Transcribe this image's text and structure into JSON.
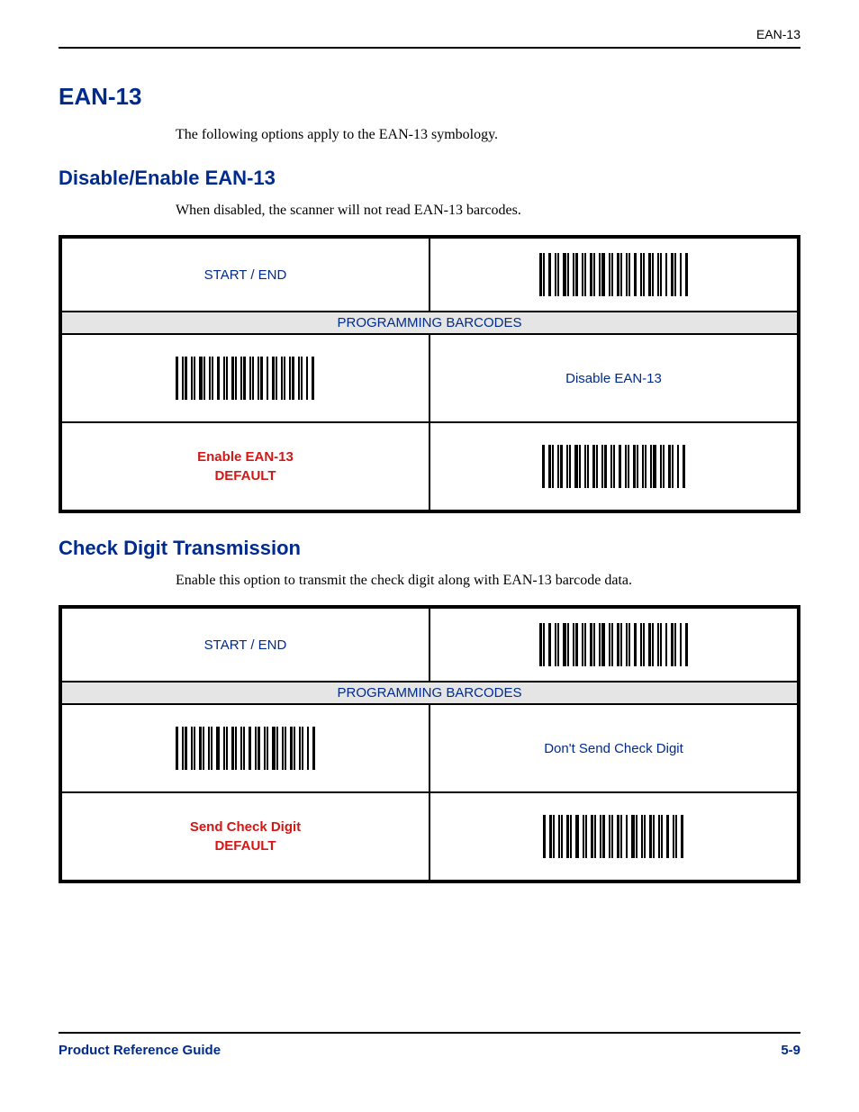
{
  "header": {
    "running_head": "EAN-13"
  },
  "section": {
    "title": "EAN-13",
    "intro": "The following options apply to the EAN-13 symbology."
  },
  "sub1": {
    "title": "Disable/Enable EAN-13",
    "intro": "When disabled, the scanner will not read EAN-13 barcodes.",
    "start_end": "START / END",
    "banner": "PROGRAMMING BARCODES",
    "opt_disable": "Disable EAN-13",
    "opt_enable_line1": "Enable EAN-13",
    "opt_enable_line2": "DEFAULT"
  },
  "sub2": {
    "title": "Check Digit Transmission",
    "intro": "Enable this option to transmit the check digit along with EAN-13 barcode data.",
    "start_end": "START / END",
    "banner": "PROGRAMMING BARCODES",
    "opt_nosend": "Don't Send Check Digit",
    "opt_send_line1": "Send Check Digit",
    "opt_send_line2": "DEFAULT"
  },
  "footer": {
    "left": "Product Reference Guide",
    "right": "5-9"
  }
}
